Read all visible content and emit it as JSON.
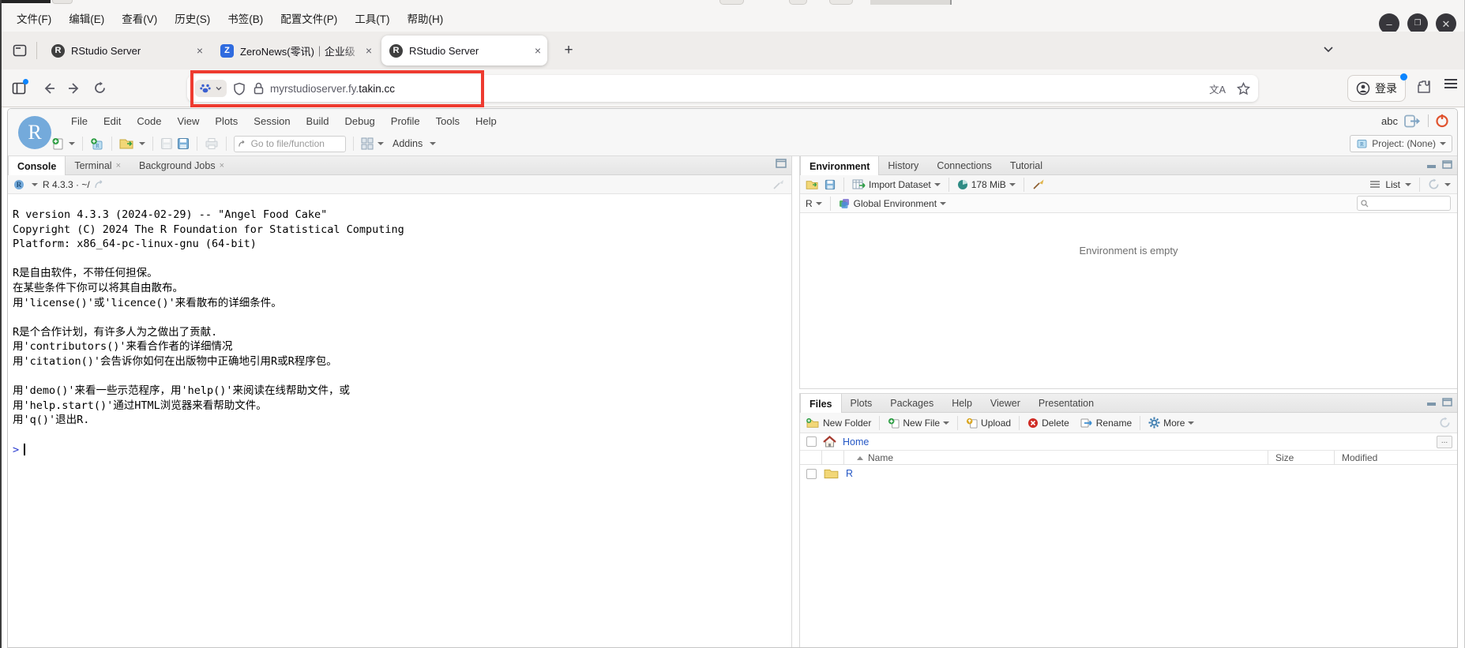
{
  "browser": {
    "menu": [
      "文件(F)",
      "编辑(E)",
      "查看(V)",
      "历史(S)",
      "书签(B)",
      "配置文件(P)",
      "工具(T)",
      "帮助(H)"
    ],
    "window_controls": {
      "minimize": "–",
      "maximize": "❐",
      "close": "✕"
    },
    "tabs": [
      {
        "title": "RStudio Server",
        "icon_letter": "R",
        "icon_bg": "#3f3f3f",
        "active": false,
        "closable": true
      },
      {
        "title": "ZeroNews(零讯)｜企业级",
        "icon_letter": "Z",
        "icon_bg": "#2f6bdf",
        "active": false,
        "closable": true
      },
      {
        "title": "RStudio Server",
        "icon_letter": "R",
        "icon_bg": "#3f3f3f",
        "active": true,
        "closable": true
      }
    ],
    "new_tab_glyph": "+",
    "navbar": {
      "url_prefix": "myrstudioserver.fy.",
      "url_domain": "takin.cc",
      "translate_glyph": "文A",
      "signin_label": "登录"
    }
  },
  "rstudio": {
    "menu": [
      "File",
      "Edit",
      "Code",
      "View",
      "Plots",
      "Session",
      "Build",
      "Debug",
      "Profile",
      "Tools",
      "Help"
    ],
    "username": "abc",
    "project_label": "Project: (None)",
    "toolbar": {
      "goto_placeholder": "Go to file/function",
      "addins_label": "Addins"
    },
    "console": {
      "tabs": [
        {
          "label": "Console",
          "active": true,
          "closable": false
        },
        {
          "label": "Terminal",
          "active": false,
          "closable": true
        },
        {
          "label": "Background Jobs",
          "active": false,
          "closable": true
        }
      ],
      "version_label": "R 4.3.3 · ~/",
      "lines": [
        "R version 4.3.3 (2024-02-29) -- \"Angel Food Cake\"",
        "Copyright (C) 2024 The R Foundation for Statistical Computing",
        "Platform: x86_64-pc-linux-gnu (64-bit)",
        "",
        "R是自由软件，不带任何担保。",
        "在某些条件下你可以将其自由散布。",
        "用'license()'或'licence()'来看散布的详细条件。",
        "",
        "R是个合作计划，有许多人为之做出了贡献.",
        "用'contributors()'来看合作者的详细情况",
        "用'citation()'会告诉你如何在出版物中正确地引用R或R程序包。",
        "",
        "用'demo()'来看一些示范程序，用'help()'来阅读在线帮助文件，或",
        "用'help.start()'通过HTML浏览器来看帮助文件。",
        "用'q()'退出R.",
        ""
      ],
      "prompt": ">"
    },
    "environment": {
      "tabs": [
        {
          "label": "Environment",
          "active": true
        },
        {
          "label": "History"
        },
        {
          "label": "Connections"
        },
        {
          "label": "Tutorial"
        }
      ],
      "import_label": "Import Dataset",
      "memory_label": "178 MiB",
      "language_label": "R",
      "scope_label": "Global Environment",
      "view_label": "List",
      "empty_message": "Environment is empty"
    },
    "files": {
      "tabs": [
        {
          "label": "Files",
          "active": true
        },
        {
          "label": "Plots"
        },
        {
          "label": "Packages"
        },
        {
          "label": "Help"
        },
        {
          "label": "Viewer"
        },
        {
          "label": "Presentation"
        }
      ],
      "new_folder_label": "New Folder",
      "new_file_label": "New File",
      "upload_label": "Upload",
      "delete_label": "Delete",
      "rename_label": "Rename",
      "more_label": "More",
      "breadcrumb": "Home",
      "ellipsis_label": "...",
      "columns": {
        "name": "Name",
        "size": "Size",
        "modified": "Modified"
      },
      "rows": [
        {
          "name": "R"
        }
      ]
    }
  },
  "annotation": {
    "color": "#ee3b30"
  }
}
